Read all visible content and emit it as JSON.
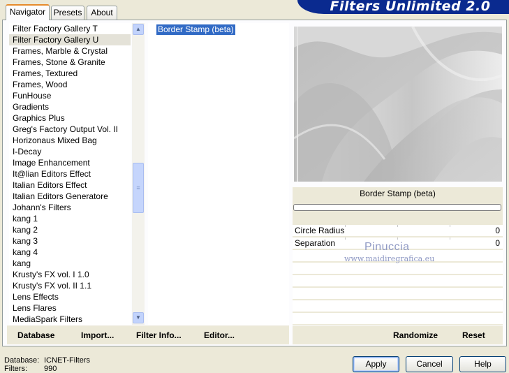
{
  "tabs": [
    {
      "label": "Navigator",
      "active": true
    },
    {
      "label": "Presets",
      "active": false
    },
    {
      "label": "About",
      "active": false
    }
  ],
  "logo": "Filters Unlimited 2.0",
  "filters": [
    "Filter Factory Gallery T",
    "Filter Factory Gallery U",
    "Frames, Marble & Crystal",
    "Frames, Stone & Granite",
    "Frames, Textured",
    "Frames, Wood",
    "FunHouse",
    "Gradients",
    "Graphics Plus",
    "Greg's Factory Output Vol. II",
    "Horizonaus Mixed Bag",
    "I-Decay",
    "Image Enhancement",
    "It@lian Editors Effect",
    "Italian Editors Effect",
    "Italian Editors Generatore",
    "Johann's Filters",
    "kang 1",
    "kang 2",
    "kang 3",
    "kang 4",
    "kang",
    "Krusty's FX vol. I 1.0",
    "Krusty's FX vol. II 1.1",
    "Lens Effects",
    "Lens Flares",
    "MediaSpark Filters"
  ],
  "selected_filter": "Filter Factory Gallery U",
  "effects": [
    "Border Stamp (beta)"
  ],
  "effect_title": "Border Stamp (beta)",
  "progress": 0,
  "params": [
    {
      "label": "Circle Radius",
      "value": "0"
    },
    {
      "label": "Separation",
      "value": "0"
    }
  ],
  "watermark": {
    "name": "Pinuccia",
    "url": "www.maidiregrafica.eu"
  },
  "left_buttons": {
    "database": "Database",
    "import": "Import...",
    "filter_info": "Filter Info...",
    "editor": "Editor..."
  },
  "right_buttons": {
    "randomize": "Randomize",
    "reset": "Reset"
  },
  "status": {
    "database_label": "Database:",
    "database_value": "ICNET-Filters",
    "filters_label": "Filters:",
    "filters_value": "990"
  },
  "dialog_buttons": {
    "apply": "Apply",
    "cancel": "Cancel",
    "help": "Help"
  },
  "colors": {
    "selection": "#316ac5",
    "logo_bg": "#0a2a8f",
    "tab_accent": "#e68b2c"
  }
}
